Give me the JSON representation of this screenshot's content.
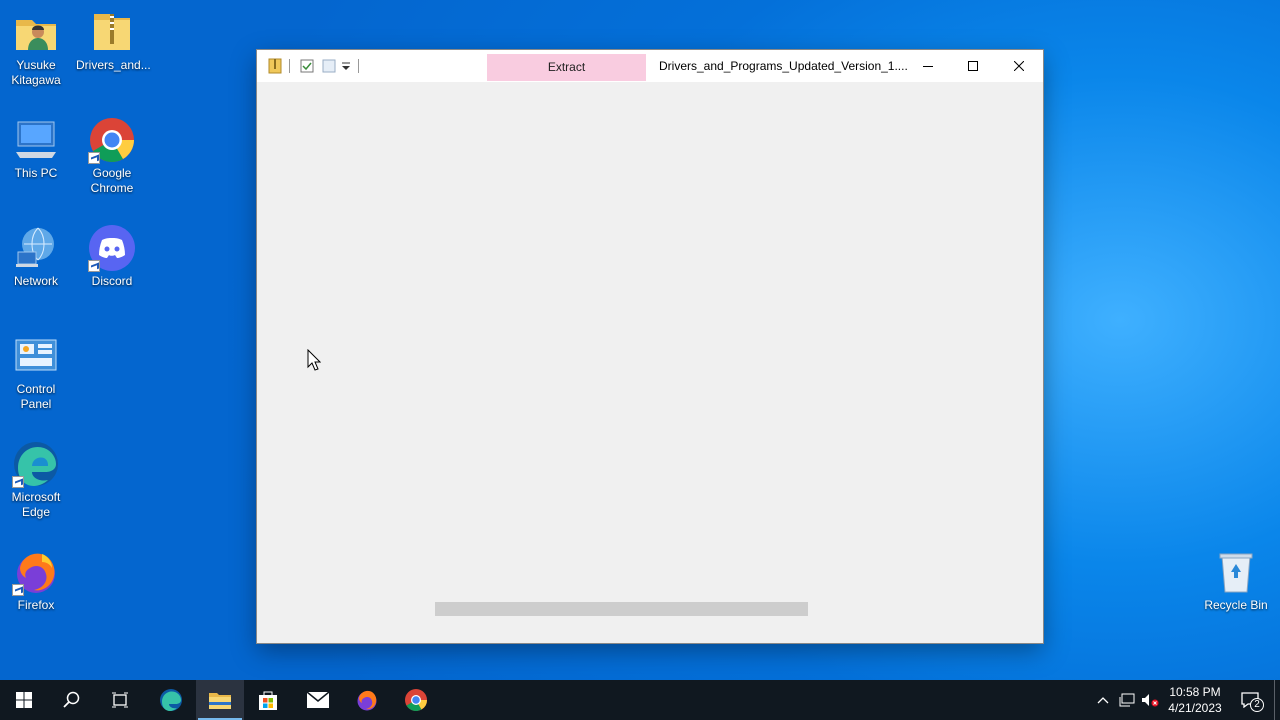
{
  "desktop": {
    "icons": [
      {
        "label": "Yusuke Kitagawa"
      },
      {
        "label": "Drivers_and..."
      },
      {
        "label": "This PC"
      },
      {
        "label": "Google Chrome"
      },
      {
        "label": "Network"
      },
      {
        "label": "Discord"
      },
      {
        "label": "Control Panel"
      },
      {
        "label": "Microsoft Edge"
      },
      {
        "label": "Firefox"
      },
      {
        "label": "Recycle Bin"
      }
    ]
  },
  "window": {
    "contextual_tab": "Extract",
    "title": "Drivers_and_Programs_Updated_Version_1....",
    "controls": {
      "minimize_icon": "minimize-icon",
      "maximize_icon": "maximize-icon",
      "close_icon": "close-icon"
    }
  },
  "taskbar": {
    "apps": [
      "start",
      "search",
      "task-view",
      "edge",
      "file-explorer",
      "store",
      "mail",
      "firefox",
      "chrome"
    ],
    "clock": {
      "time": "10:58 PM",
      "date": "4/21/2023"
    },
    "notification_count": "2"
  },
  "colors": {
    "accent": "#0078d7",
    "contextual_tab": "#f9cce0"
  }
}
